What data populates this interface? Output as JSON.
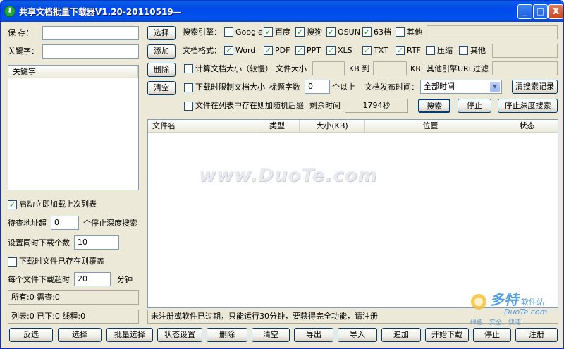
{
  "window": {
    "title": "共享文档批量下载器V1.20-20110519—",
    "controls": [
      "_",
      "□",
      "X"
    ]
  },
  "left": {
    "save_label": "保  存：",
    "save_value": "",
    "keyword_label": "关键字：",
    "keyword_value": "",
    "keyword_list_header": "关键字",
    "autoload_label": "启动立即加载上次列表",
    "autoload_checked": true,
    "pending_label": "待查地址超",
    "pending_value": "0",
    "pending_suffix": "个停止深度搜索",
    "concurrent_label": "设置同时下载个数",
    "concurrent_value": "10",
    "overwrite_label": "下载时文件已存在则覆盖",
    "overwrite_checked": false,
    "timeout_label": "每个文件下载超时",
    "timeout_value": "20",
    "timeout_unit": "分钟",
    "status_all": "所有:0 需查:0",
    "status_list": "列表:0 已下:0 线程:0"
  },
  "buttons": {
    "select": "选择",
    "add": "添加",
    "delete": "删除",
    "clear": "清空",
    "clear_search": "清搜索记录",
    "search": "搜索",
    "stop": "停止",
    "stop_deep": "停止深度搜索"
  },
  "engines": {
    "label": "搜索引擎：",
    "items": [
      {
        "name": "Google",
        "checked": false
      },
      {
        "name": "百度",
        "checked": true
      },
      {
        "name": "搜狗",
        "checked": true
      },
      {
        "name": "OSUN",
        "checked": true
      },
      {
        "name": "63档",
        "checked": true
      },
      {
        "name": "其他",
        "checked": false
      }
    ]
  },
  "formats": {
    "label": "文档格式：",
    "items": [
      {
        "name": "Word",
        "checked": true
      },
      {
        "name": "PDF",
        "checked": true
      },
      {
        "name": "PPT",
        "checked": true
      },
      {
        "name": "XLS",
        "checked": true
      },
      {
        "name": "TXT",
        "checked": true
      },
      {
        "name": "RTF",
        "checked": true
      },
      {
        "name": "压缩",
        "checked": false
      },
      {
        "name": "其他",
        "checked": false
      }
    ]
  },
  "options": {
    "calc_size_label": "计算文档大小（较慢）",
    "file_size_label": "文件大小",
    "kb_to": "KB 到",
    "kb": "KB",
    "url_filter_label": "其他引擎URL过滤",
    "limit_size_label": "下载时限制文档大小",
    "title_chars_label": "标题字数",
    "title_chars_value": "0",
    "title_chars_suffix": "个以上",
    "publish_time_label": "文档发布时间：",
    "publish_time_value": "全部时间",
    "random_suffix_label": "文件在列表中存在则加随机后缀",
    "remaining_label": "剩余时间",
    "remaining_value": "1794秒"
  },
  "table": {
    "columns": [
      "文件名",
      "类型",
      "大小(KB)",
      "位置",
      "状态"
    ]
  },
  "status_message": "未注册或软件已过期，只能运行30分钟，要获得完全功能，请注册",
  "watermark": "www.DuoTe.com",
  "logo": {
    "brand": "多特",
    "sub": "软件站",
    "site": "DuoTe.com",
    "slogan": "绿色、安全、快速"
  },
  "bottom_buttons": [
    "反选",
    "选择",
    "批量选择",
    "状态设置",
    "删除",
    "清空",
    "导出",
    "导入",
    "追加",
    "开始下载",
    "停止",
    "注册"
  ],
  "colors": {
    "title_bar": "#0054e3",
    "window_bg": "#ece9d8",
    "check": "#21a121"
  }
}
